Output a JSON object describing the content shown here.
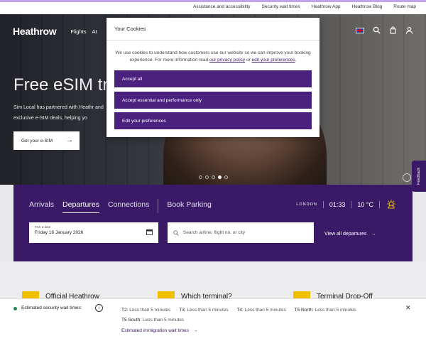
{
  "utility_links": [
    "Assistance and accessibility",
    "Security wait times",
    "Heathrow App",
    "Heathrow Blog",
    "Route map"
  ],
  "nav": {
    "logo": "Heathrow",
    "links": [
      "Flights",
      "At"
    ],
    "search_icon": "search-icon",
    "bag_icon": "bag-icon",
    "user_icon": "user-icon"
  },
  "hero": {
    "title": "Free eSIM tri",
    "text": "Sim Local has partnered with Heathr and exclusive e-SIM deals, helping yo",
    "cta_label": "Get your e-SIM",
    "cta_arrow": "→",
    "slide_count": 5,
    "active_slide": 4
  },
  "cookie": {
    "title": "Your Cookies",
    "text_before": "We use cookies to understand how customers use our website so we can improve your booking experience. For more information read ",
    "privacy_link": "our privacy policy",
    "text_or": " or ",
    "prefs_link": "edit your preferences",
    "text_end": ".",
    "buttons": [
      "Accept all",
      "Accept essential and performance only",
      "Edit your preferences"
    ]
  },
  "flights": {
    "tabs": [
      "Arrivals",
      "Departures",
      "Connections",
      "Book Parking"
    ],
    "active_tab": "Departures",
    "city": "LONDON",
    "time": "01:33",
    "temp": "10 °C",
    "date_label": "Pick a date",
    "date_value": "Friday 16 January 2026",
    "search_placeholder": "Search airline, flight no. or city",
    "view_all": "View all departures",
    "view_all_arrow": "→"
  },
  "cards": [
    "Official Heathrow",
    "Which terminal?",
    "Terminal Drop-Off"
  ],
  "security": {
    "title": "Estimated security wait times:",
    "info": "i",
    "times": [
      {
        "terminal": "T2:",
        "value": "Less than 5 minutes"
      },
      {
        "terminal": "T3:",
        "value": "Less than 5 minutes"
      },
      {
        "terminal": "T4:",
        "value": "Less than 5 minutes"
      },
      {
        "terminal": "T5 North:",
        "value": "Less than 5 minutes"
      },
      {
        "terminal": "T5 South:",
        "value": "Less than 5 minutes"
      }
    ],
    "immigration_link": "Estimated immigration wait times",
    "immigration_arrow": "→",
    "close": "✕"
  },
  "feedback": "Feedback",
  "colors": {
    "brand_purple": "#3a1a66",
    "button_purple": "#4b217f",
    "accent_yellow": "#f0c000",
    "status_green": "#1f8b4c"
  }
}
